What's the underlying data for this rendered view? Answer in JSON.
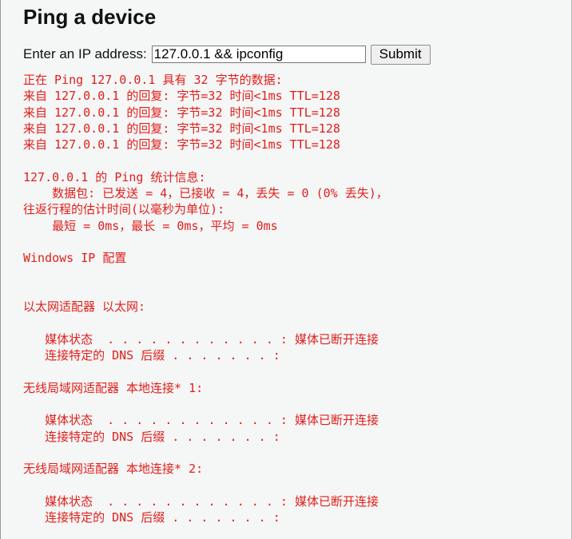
{
  "page": {
    "title": "Ping a device"
  },
  "form": {
    "label": "Enter an IP address:",
    "ip_value": "127.0.0.1 && ipconfig",
    "submit_label": "Submit"
  },
  "output": {
    "lines": [
      "正在 Ping 127.0.0.1 具有 32 字节的数据:",
      "来自 127.0.0.1 的回复: 字节=32 时间<1ms TTL=128",
      "来自 127.0.0.1 的回复: 字节=32 时间<1ms TTL=128",
      "来自 127.0.0.1 的回复: 字节=32 时间<1ms TTL=128",
      "来自 127.0.0.1 的回复: 字节=32 时间<1ms TTL=128",
      "",
      "127.0.0.1 的 Ping 统计信息:",
      "    数据包: 已发送 = 4，已接收 = 4，丢失 = 0 (0% 丢失)，",
      "往返行程的估计时间(以毫秒为单位):",
      "    最短 = 0ms，最长 = 0ms，平均 = 0ms",
      "",
      "Windows IP 配置",
      "",
      "",
      "以太网适配器 以太网:",
      "",
      "   媒体状态  . . . . . . . . . . . . : 媒体已断开连接",
      "   连接特定的 DNS 后缀 . . . . . . . :",
      "",
      "无线局域网适配器 本地连接* 1:",
      "",
      "   媒体状态  . . . . . . . . . . . . : 媒体已断开连接",
      "   连接特定的 DNS 后缀 . . . . . . . :",
      "",
      "无线局域网适配器 本地连接* 2:",
      "",
      "   媒体状态  . . . . . . . . . . . . : 媒体已断开连接",
      "   连接特定的 DNS 后缀 . . . . . . . :"
    ]
  },
  "colors": {
    "output_text": "#e0201c",
    "background": "#f5f6f6"
  }
}
